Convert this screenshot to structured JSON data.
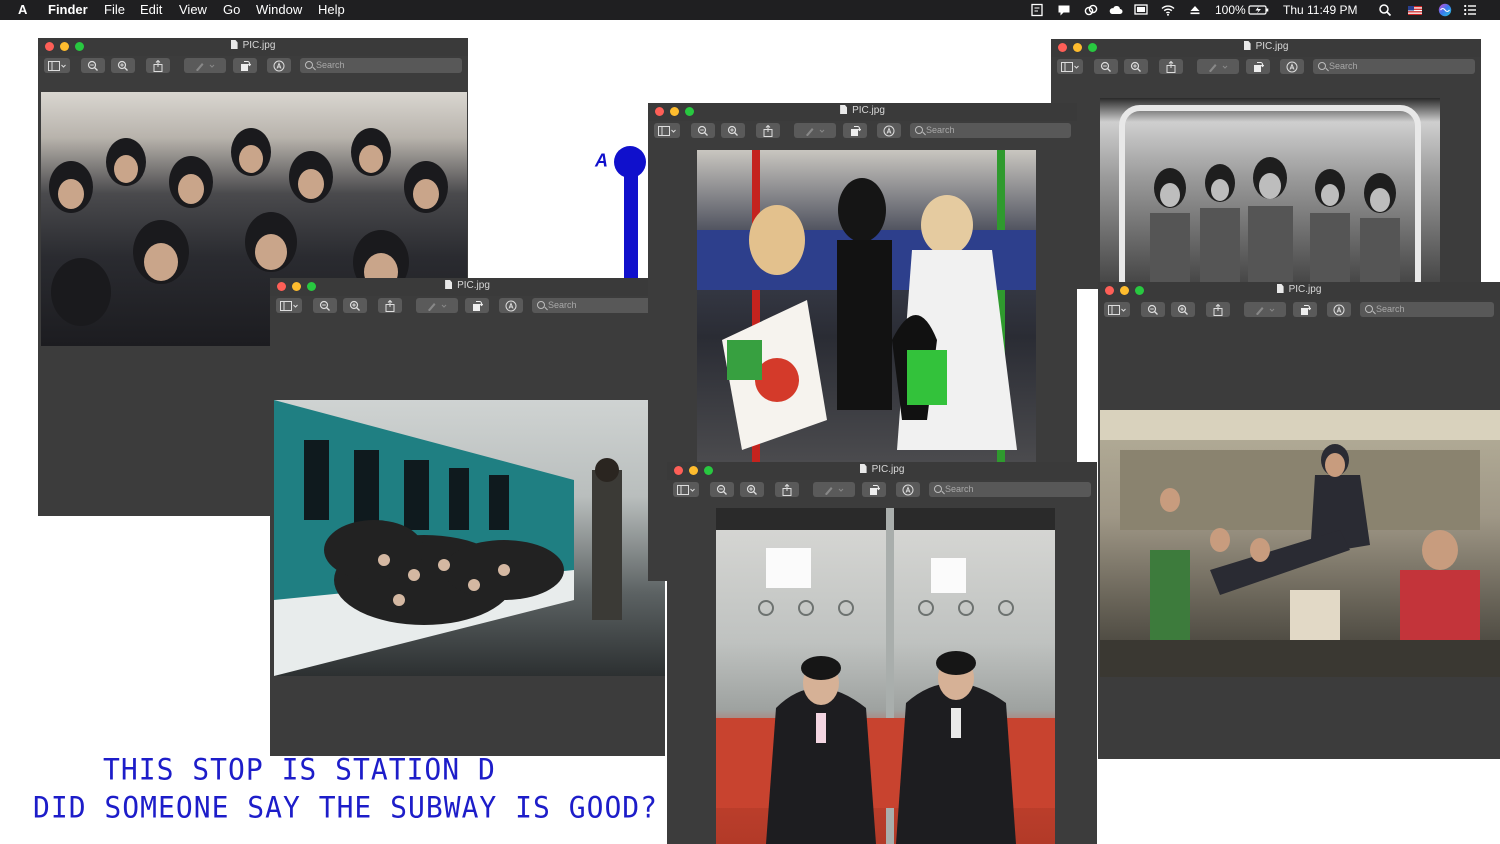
{
  "menubar": {
    "apple": "A",
    "app": "Finder",
    "menus": [
      "File",
      "Edit",
      "View",
      "Go",
      "Window",
      "Help"
    ],
    "battery": "100%",
    "clock": "Thu 11:49 PM",
    "icons": [
      "notes-icon",
      "chat-icon",
      "creative-cloud-icon",
      "cloud-icon",
      "display-icon",
      "wifi-icon",
      "eject-icon",
      "battery-icon",
      "spotlight-search-icon",
      "flag-icon",
      "siri-icon",
      "control-center-icon"
    ]
  },
  "windows": [
    {
      "id": "w1",
      "title": "PIC.jpg",
      "search_placeholder": "Search"
    },
    {
      "id": "w2",
      "title": "PIC.jpg",
      "search_placeholder": "Search"
    },
    {
      "id": "w3",
      "title": "PIC.jpg",
      "search_placeholder": "Search"
    },
    {
      "id": "w4",
      "title": "PIC.jpg",
      "search_placeholder": "Search"
    },
    {
      "id": "w5",
      "title": "PIC.jpg",
      "search_placeholder": "Search"
    },
    {
      "id": "w6",
      "title": "PIC.jpg",
      "search_placeholder": "Search"
    }
  ],
  "metro_sign": {
    "letter": "A",
    "color": "#1010cc"
  },
  "caption": {
    "line1": "THIS STOP IS STATION D",
    "line2": "DID SOMEONE SAY THE SUBWAY IS GOOD?",
    "color": "#1d1dc9"
  }
}
